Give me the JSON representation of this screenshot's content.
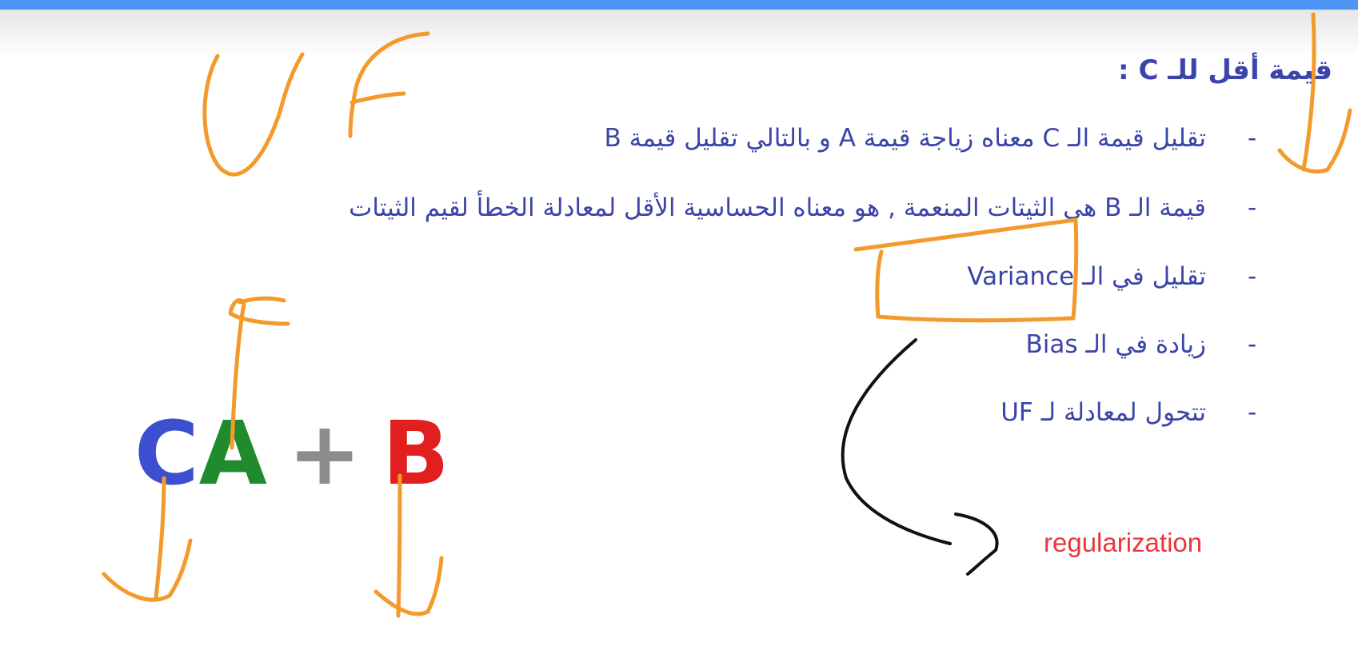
{
  "slide": {
    "title": "قيمة أقل للـ  C :",
    "bullets": [
      "تقليل  قيمة الـ  C معناه  زياجة قيمة  A و بالتالي تقليل قيمة  B",
      "قيمة الـ  B هي الثيتات  المنعمة , هو معناه  الحساسية الأقل لمعادلة الخطأ لقيم الثيتات",
      "تقليل في الـ  Variance",
      "زيادة في الـ  Bias",
      "تتحول لمعادلة لـ  UF"
    ],
    "dash": "-",
    "formula": {
      "c": "C",
      "a": "A",
      "plus": "+",
      "b": "B",
      "colors": {
        "c": "#3b4fd0",
        "a": "#1f8a2e",
        "plus": "#8c8c8c",
        "b": "#e11f1f"
      }
    },
    "annotation_text": "regularization"
  },
  "colors": {
    "top_bar": "#4e94f5",
    "text": "#3b44a8",
    "ink_orange": "#f39a2b",
    "ink_black": "#111111",
    "note_red": "#e8373a"
  }
}
